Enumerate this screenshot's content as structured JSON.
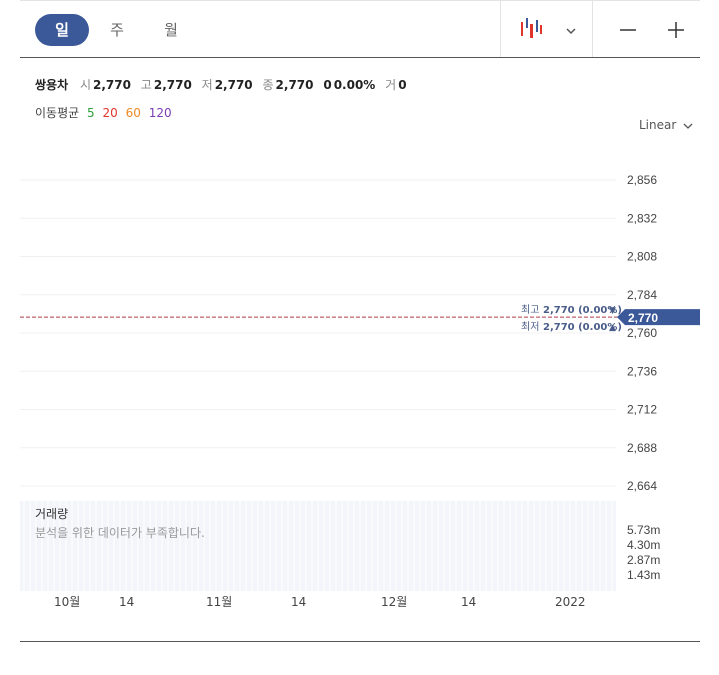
{
  "toolbar": {
    "periods": [
      "일",
      "주",
      "월"
    ],
    "active_period": "일",
    "chart_type_icon": "candlestick-icon",
    "zoom_out_icon": "minus-icon",
    "zoom_in_icon": "plus-icon"
  },
  "quote": {
    "name": "쌍용차",
    "open_label": "시",
    "open": "2,770",
    "high_label": "고",
    "high": "2,770",
    "low_label": "저",
    "low": "2,770",
    "close_label": "종",
    "close": "2,770",
    "change": "0",
    "change_pct": "0.00%",
    "volume_label": "거",
    "volume": "0"
  },
  "moving_average": {
    "label": "이동평균",
    "periods": [
      {
        "label": "5",
        "color": "#2e9e3b"
      },
      {
        "label": "20",
        "color": "#e0352b"
      },
      {
        "label": "60",
        "color": "#f08a24"
      },
      {
        "label": "120",
        "color": "#7b3fb5"
      }
    ]
  },
  "scale_select": "Linear",
  "chart_data": {
    "type": "line",
    "title": "",
    "price_axis": {
      "ticks": [
        "2,856",
        "2,832",
        "2,808",
        "2,784",
        "2,760",
        "2,736",
        "2,712",
        "2,688",
        "2,664"
      ],
      "tick_values": [
        2856,
        2832,
        2808,
        2784,
        2760,
        2736,
        2712,
        2688,
        2664
      ],
      "ylim": [
        2664,
        2856
      ]
    },
    "current_price": {
      "value": 2770,
      "label": "2,770"
    },
    "high_annotation": {
      "label": "최고",
      "value_text": "2,770 (0.00%)",
      "marker": "▼"
    },
    "low_annotation": {
      "label": "최저",
      "value_text": "2,770 (0.00%)",
      "marker": "▲"
    },
    "x_axis": {
      "ticks": [
        "10월",
        "14",
        "11월",
        "14",
        "12월",
        "14",
        "2022"
      ]
    },
    "volume_panel": {
      "title": "거래량",
      "message": "분석을 위한 데이터가 부족합니다.",
      "ticks": [
        "5.73m",
        "4.30m",
        "2.87m",
        "1.43m"
      ]
    },
    "series": [
      {
        "values": [
          2770
        ]
      }
    ],
    "grid": true,
    "colors": {
      "accent": "#3b5998",
      "price_line": "#b03a4a",
      "grid": "#f0f0f0",
      "volume_bg": "#f3f5fa"
    }
  }
}
